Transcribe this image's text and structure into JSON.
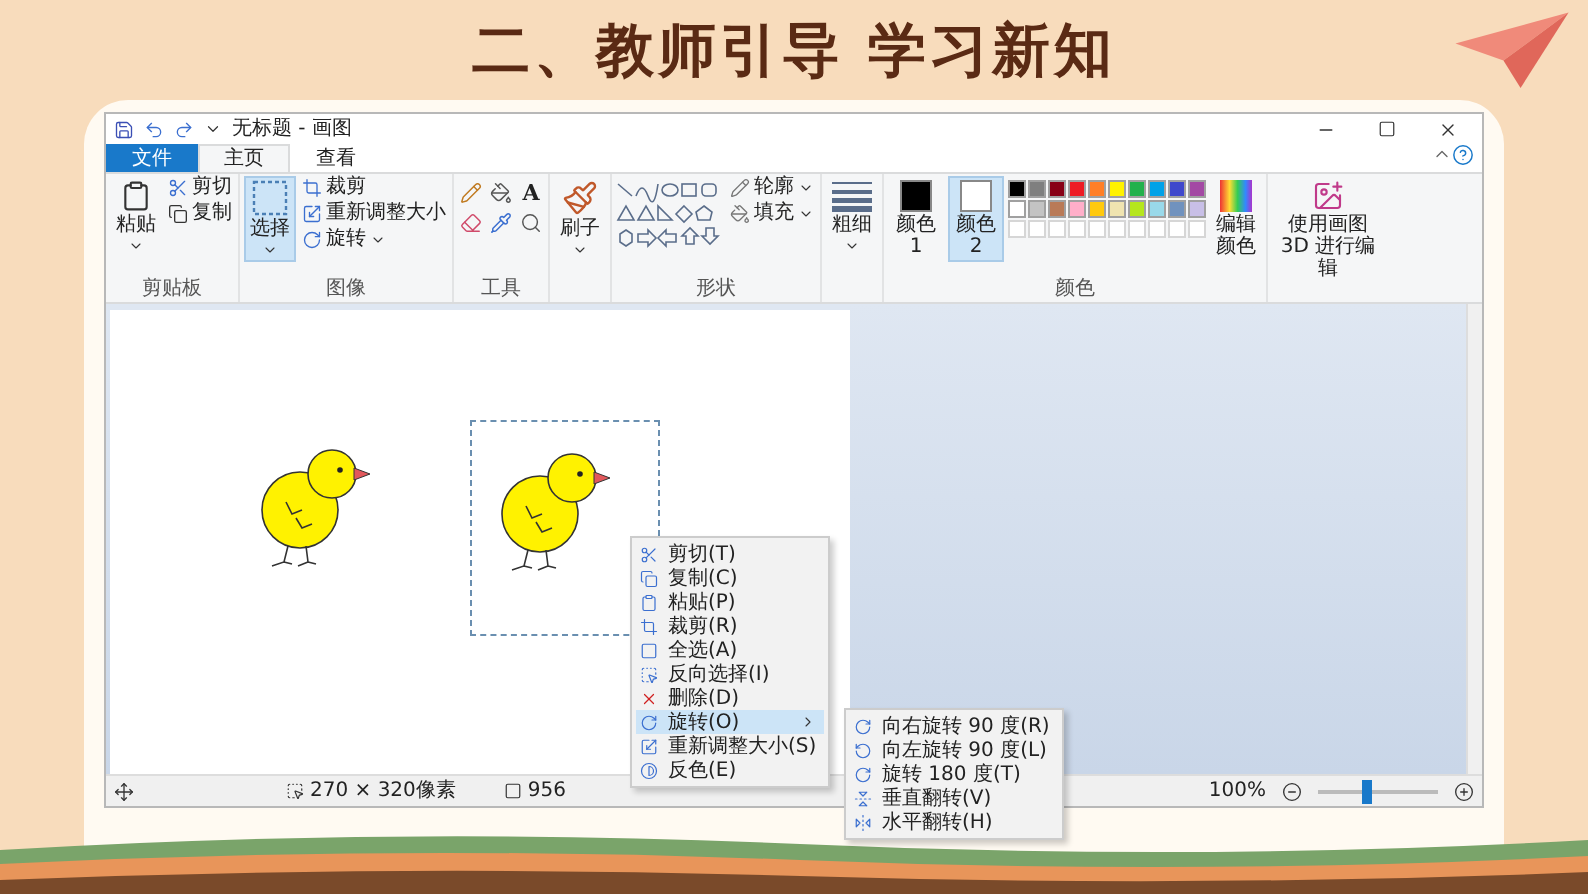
{
  "slide": {
    "title": "二、教师引导 学习新知"
  },
  "window": {
    "title": "无标题 - 画图"
  },
  "menu_tabs": [
    {
      "label": "文件",
      "kind": "file",
      "selected": false
    },
    {
      "label": "主页",
      "kind": "tab",
      "selected": true
    },
    {
      "label": "查看",
      "kind": "tab",
      "selected": false
    }
  ],
  "ribbon": {
    "clipboard": {
      "paste": "粘贴",
      "cut": "剪切",
      "copy": "复制",
      "group": "剪贴板"
    },
    "image": {
      "select": "选择",
      "crop": "裁剪",
      "resize": "重新调整大小",
      "rotate": "旋转",
      "group": "图像"
    },
    "tools": {
      "text_tool": "A",
      "group": "工具"
    },
    "brush": {
      "label": "刷子"
    },
    "shapes": {
      "outline": "轮廓",
      "fill": "填充",
      "group": "形状"
    },
    "thickness": {
      "label": "粗细"
    },
    "colors": {
      "group": "颜色",
      "edit": "编辑颜色",
      "paint3d": "使用画图 3D 进行编辑",
      "slots": [
        {
          "label": "颜色 1",
          "color": "#000000",
          "selected": false
        },
        {
          "label": "颜色 2",
          "color": "#ffffff",
          "selected": true
        }
      ],
      "palette": [
        {
          "kind": "color",
          "color": "#000000"
        },
        {
          "kind": "color",
          "color": "#7f7f7f"
        },
        {
          "kind": "color",
          "color": "#880015"
        },
        {
          "kind": "color",
          "color": "#ed1c24"
        },
        {
          "kind": "color",
          "color": "#ff7f27"
        },
        {
          "kind": "color",
          "color": "#fff200"
        },
        {
          "kind": "color",
          "color": "#22b14c"
        },
        {
          "kind": "color",
          "color": "#00a2e8"
        },
        {
          "kind": "color",
          "color": "#3f48cc"
        },
        {
          "kind": "color",
          "color": "#a349a4"
        },
        {
          "kind": "color",
          "color": "#ffffff"
        },
        {
          "kind": "color",
          "color": "#c3c3c3"
        },
        {
          "kind": "color",
          "color": "#b97a57"
        },
        {
          "kind": "color",
          "color": "#ffaec9"
        },
        {
          "kind": "color",
          "color": "#ffc90e"
        },
        {
          "kind": "color",
          "color": "#efe4b0"
        },
        {
          "kind": "color",
          "color": "#b5e61d"
        },
        {
          "kind": "color",
          "color": "#99d9ea"
        },
        {
          "kind": "color",
          "color": "#7092be"
        },
        {
          "kind": "color",
          "color": "#c8bfe7"
        },
        {
          "kind": "empty"
        },
        {
          "kind": "empty"
        },
        {
          "kind": "empty"
        },
        {
          "kind": "empty"
        },
        {
          "kind": "empty"
        },
        {
          "kind": "empty"
        },
        {
          "kind": "empty"
        },
        {
          "kind": "empty"
        },
        {
          "kind": "empty"
        },
        {
          "kind": "empty"
        }
      ]
    }
  },
  "status_bar": {
    "selection_size": "270 × 320像素",
    "image_size": "956",
    "zoom": "100%",
    "zoom_slider": {
      "level": 0.4
    }
  },
  "context_menu": {
    "items": [
      {
        "label": "剪切(T)",
        "kind": "cut",
        "selected": false
      },
      {
        "label": "复制(C)",
        "kind": "copy",
        "selected": false
      },
      {
        "label": "粘贴(P)",
        "kind": "paste",
        "selected": false
      },
      {
        "label": "裁剪(R)",
        "kind": "crop",
        "selected": false
      },
      {
        "label": "全选(A)",
        "kind": "select_all",
        "selected": false
      },
      {
        "label": "反向选择(I)",
        "kind": "invert_selection",
        "selected": false
      },
      {
        "label": "删除(D)",
        "kind": "delete",
        "selected": false
      },
      {
        "label": "旋转(O)",
        "kind": "rotate",
        "selected": true
      },
      {
        "label": "重新调整大小(S)",
        "kind": "resize",
        "selected": false
      },
      {
        "label": "反色(E)",
        "kind": "invert_color",
        "selected": false
      }
    ]
  },
  "submenu": {
    "items": [
      {
        "label": "向右旋转 90 度(R)",
        "kind": "rotate_right"
      },
      {
        "label": "向左旋转 90 度(L)",
        "kind": "rotate_left"
      },
      {
        "label": "旋转 180 度(T)",
        "kind": "rotate_180"
      },
      {
        "label": "垂直翻转(V)",
        "kind": "flip_vertical"
      },
      {
        "label": "水平翻转(H)",
        "kind": "flip_horizontal"
      }
    ]
  }
}
